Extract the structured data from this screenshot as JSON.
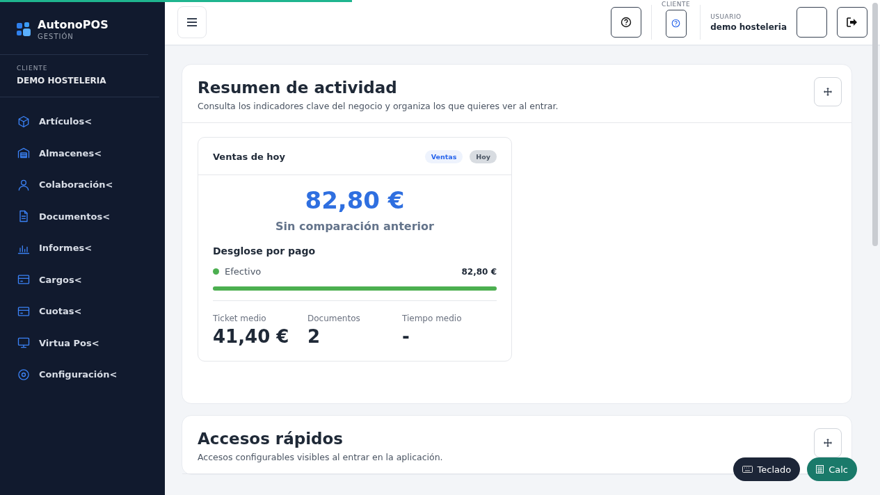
{
  "loading_bar": {
    "level": 0.4
  },
  "sidebar": {
    "brand": {
      "name": "AutonoPOS",
      "subtitle": "GESTIÓN"
    },
    "client": {
      "label": "CLIENTE",
      "name": "DEMO HOSTELERIA"
    },
    "items": [
      {
        "label": "Artículos<"
      },
      {
        "label": "Almacenes<"
      },
      {
        "label": "Colaboración<"
      },
      {
        "label": "Documentos<"
      },
      {
        "label": "Informes<"
      },
      {
        "label": "Cargos<"
      },
      {
        "label": "Cuotas<"
      },
      {
        "label": "Virtua Pos<"
      },
      {
        "label": "Configuración<"
      }
    ]
  },
  "header": {
    "client_label": "CLIENTE",
    "user_label": "USUARIO",
    "user_name": "demo hosteleria"
  },
  "sections": [
    {
      "title": "Resumen de actividad",
      "subtitle": "Consulta los indicadores clave del negocio y organiza los que quieres ver al entrar.",
      "card": {
        "title": "Ventas de hoy",
        "tags": [
          "Ventas",
          "Hoy"
        ],
        "amount": "82,80 €",
        "comparison": "Sin comparación anterior",
        "breakdown_title": "Desglose por pago",
        "payments": [
          {
            "name": "Efectivo",
            "amount": "82,80 €",
            "color": "#4caf50",
            "level": 1
          }
        ],
        "stats": [
          {
            "label": "Ticket medio",
            "value": "41,40 €"
          },
          {
            "label": "Documentos",
            "value": "2"
          },
          {
            "label": "Tiempo medio",
            "value": "-"
          }
        ]
      }
    },
    {
      "title": "Accesos rápidos",
      "subtitle": "Accesos configurables visibles al entrar en la aplicación."
    }
  ],
  "floating_buttons": [
    {
      "label": "Teclado",
      "kind": "keyboard"
    },
    {
      "label": "Calc",
      "kind": "calculator"
    }
  ]
}
